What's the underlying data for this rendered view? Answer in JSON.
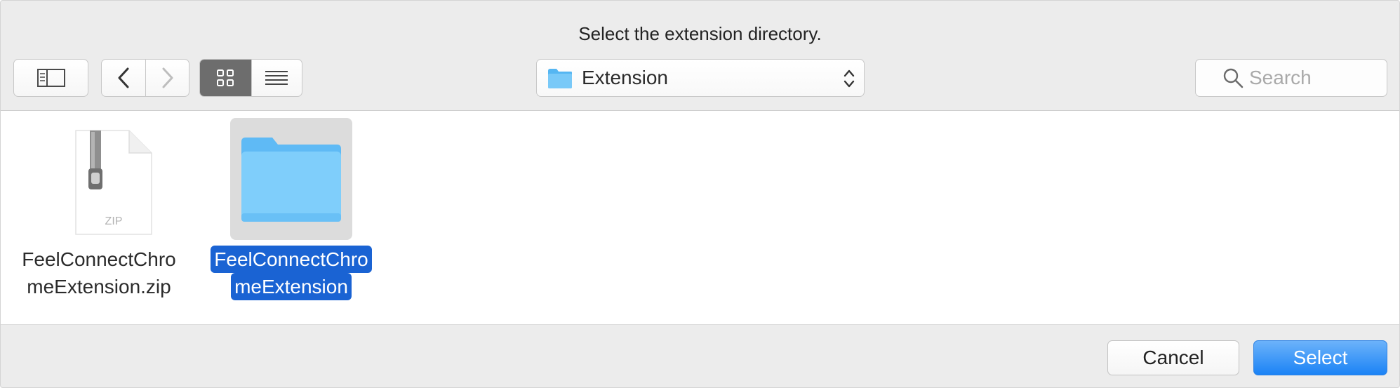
{
  "dialog": {
    "title": "Select the extension directory."
  },
  "toolbar": {
    "location": "Extension",
    "search_placeholder": "Search"
  },
  "files": [
    {
      "name_line1": "FeelConnectChro",
      "name_line2": "meExtension.zip",
      "badge": "ZIP",
      "icon": "zip-file-icon",
      "selected": false
    },
    {
      "name_line1": "FeelConnectChro",
      "name_line2": "meExtension",
      "icon": "folder-icon",
      "selected": true
    }
  ],
  "footer": {
    "cancel_label": "Cancel",
    "select_label": "Select"
  },
  "colors": {
    "selection": "#1a63d3",
    "folder": "#6cc4f7",
    "primary_button": "#1b83f5"
  }
}
